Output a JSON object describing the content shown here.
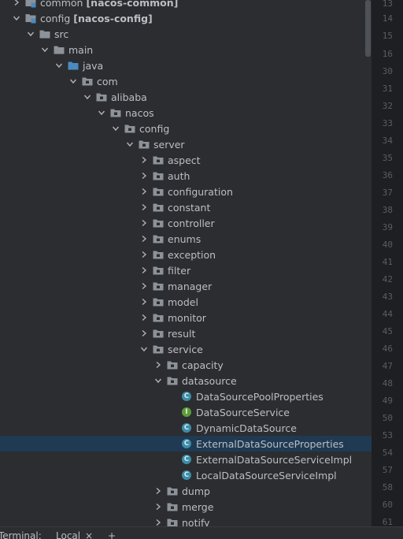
{
  "tree": [
    {
      "label": "common",
      "module": "[nacos-common]",
      "depth": 0,
      "expand": "collapsed",
      "icon": "module-folder-icon"
    },
    {
      "label": "config",
      "module": "[nacos-config]",
      "depth": 0,
      "expand": "expanded",
      "icon": "module-folder-icon"
    },
    {
      "label": "src",
      "depth": 1,
      "expand": "expanded",
      "icon": "folder-icon"
    },
    {
      "label": "main",
      "depth": 2,
      "expand": "expanded",
      "icon": "folder-icon"
    },
    {
      "label": "java",
      "depth": 3,
      "expand": "expanded",
      "icon": "source-folder-icon"
    },
    {
      "label": "com",
      "depth": 4,
      "expand": "expanded",
      "icon": "package-icon"
    },
    {
      "label": "alibaba",
      "depth": 5,
      "expand": "expanded",
      "icon": "package-icon"
    },
    {
      "label": "nacos",
      "depth": 6,
      "expand": "expanded",
      "icon": "package-icon"
    },
    {
      "label": "config",
      "depth": 7,
      "expand": "expanded",
      "icon": "package-icon"
    },
    {
      "label": "server",
      "depth": 8,
      "expand": "expanded",
      "icon": "package-icon"
    },
    {
      "label": "aspect",
      "depth": 9,
      "expand": "collapsed",
      "icon": "package-icon"
    },
    {
      "label": "auth",
      "depth": 9,
      "expand": "collapsed",
      "icon": "package-icon"
    },
    {
      "label": "configuration",
      "depth": 9,
      "expand": "collapsed",
      "icon": "package-icon"
    },
    {
      "label": "constant",
      "depth": 9,
      "expand": "collapsed",
      "icon": "package-icon"
    },
    {
      "label": "controller",
      "depth": 9,
      "expand": "collapsed",
      "icon": "package-icon"
    },
    {
      "label": "enums",
      "depth": 9,
      "expand": "collapsed",
      "icon": "package-icon"
    },
    {
      "label": "exception",
      "depth": 9,
      "expand": "collapsed",
      "icon": "package-icon"
    },
    {
      "label": "filter",
      "depth": 9,
      "expand": "collapsed",
      "icon": "package-icon"
    },
    {
      "label": "manager",
      "depth": 9,
      "expand": "collapsed",
      "icon": "package-icon"
    },
    {
      "label": "model",
      "depth": 9,
      "expand": "collapsed",
      "icon": "package-icon"
    },
    {
      "label": "monitor",
      "depth": 9,
      "expand": "collapsed",
      "icon": "package-icon"
    },
    {
      "label": "result",
      "depth": 9,
      "expand": "collapsed",
      "icon": "package-icon"
    },
    {
      "label": "service",
      "depth": 9,
      "expand": "expanded",
      "icon": "package-icon"
    },
    {
      "label": "capacity",
      "depth": 10,
      "expand": "collapsed",
      "icon": "package-icon"
    },
    {
      "label": "datasource",
      "depth": 10,
      "expand": "expanded",
      "icon": "package-icon"
    },
    {
      "label": "DataSourcePoolProperties",
      "depth": 11,
      "expand": "none",
      "icon": "class-icon"
    },
    {
      "label": "DataSourceService",
      "depth": 11,
      "expand": "none",
      "icon": "interface-icon"
    },
    {
      "label": "DynamicDataSource",
      "depth": 11,
      "expand": "none",
      "icon": "class-icon"
    },
    {
      "label": "ExternalDataSourceProperties",
      "depth": 11,
      "expand": "none",
      "icon": "class-icon",
      "selected": true
    },
    {
      "label": "ExternalDataSourceServiceImpl",
      "depth": 11,
      "expand": "none",
      "icon": "class-icon"
    },
    {
      "label": "LocalDataSourceServiceImpl",
      "depth": 11,
      "expand": "none",
      "icon": "class-icon"
    },
    {
      "label": "dump",
      "depth": 10,
      "expand": "collapsed",
      "icon": "package-icon"
    },
    {
      "label": "merge",
      "depth": 10,
      "expand": "collapsed",
      "icon": "package-icon"
    },
    {
      "label": "notify",
      "depth": 10,
      "expand": "collapsed",
      "icon": "package-icon"
    }
  ],
  "line_numbers": [
    "13",
    "14",
    "15",
    "16",
    "30",
    "31",
    "32",
    "33",
    "34",
    "35",
    "36",
    "37",
    "38",
    "39",
    "40",
    "41",
    "42",
    "43",
    "44",
    "45",
    "46",
    "47",
    "48",
    "49",
    "50",
    "53",
    "54",
    "57",
    "58",
    "60",
    "61",
    "62"
  ],
  "icon_letters": {
    "class": "C",
    "interface": "I"
  },
  "statusbar": {
    "terminal": "Terminal:",
    "local": "Local",
    "close": "×",
    "add": "+"
  },
  "colors": {
    "background": "#2b2d30",
    "selection": "#1f3a52",
    "gutter": "#1e1f22",
    "package_icon": "#8c9298",
    "source_folder_icon": "#4a8ac1",
    "class_icon": "#3c8da8",
    "interface_icon": "#5e9c3a"
  }
}
